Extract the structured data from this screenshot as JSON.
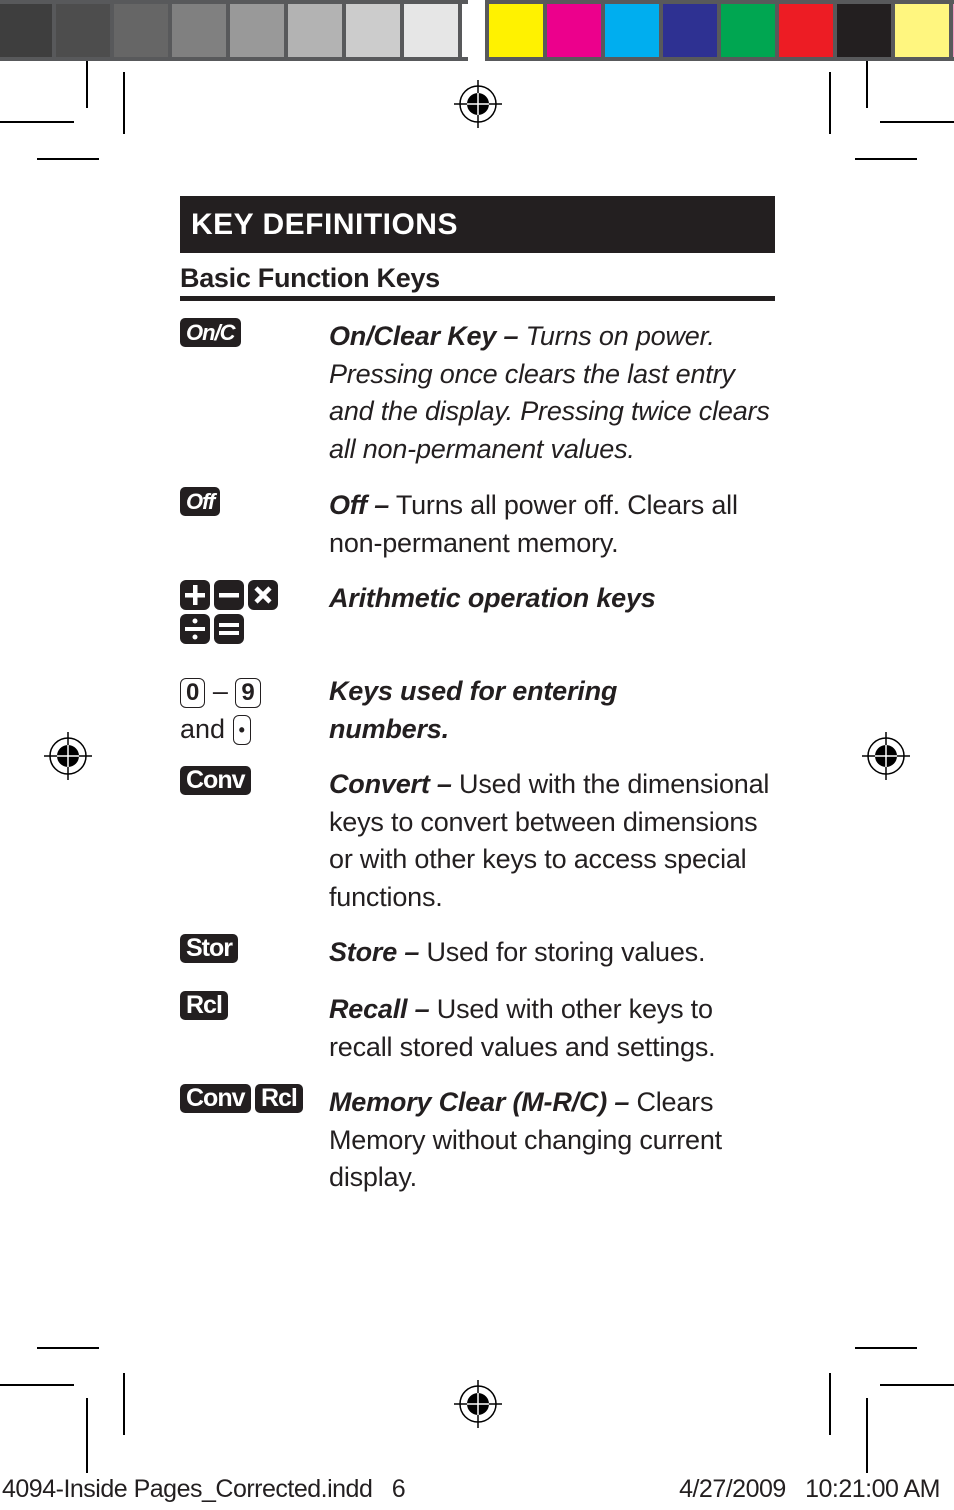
{
  "color_bar": {
    "grays": [
      "#4d4d4d",
      "#666666",
      "#808080",
      "#999999",
      "#b3b3b3",
      "#cccccc",
      "#e6e6e6",
      "#ffffff"
    ],
    "colors": [
      "#fff200",
      "#ec008c",
      "#00aeef",
      "#2e3192",
      "#00a651",
      "#ed1c24",
      "#231f20",
      "#fff67f"
    ]
  },
  "page": {
    "banner_title": "KEY DEFINITIONS",
    "section_heading": "Basic Function Keys"
  },
  "entries": [
    {
      "keys": [
        "On/C"
      ],
      "term": "On/Clear Key –",
      "text": " Turns on power. Pressing once clears the last entry and the display. Pressing twice clears all non-permanent values.",
      "text_italic": true
    },
    {
      "keys": [
        "Off"
      ],
      "term": "Off –",
      "text": " Turns all power off. Clears all non-permanent memory."
    },
    {
      "keys": [
        "plus",
        "minus",
        "multiply",
        "divide",
        "equals"
      ],
      "term": "Arithmetic operation keys",
      "text": ""
    },
    {
      "keys": [
        "0",
        "9",
        "•"
      ],
      "key_connector": "–",
      "key_and": "and",
      "term": "Keys used for entering numbers.",
      "text": ""
    },
    {
      "keys": [
        "Conv"
      ],
      "term": "Convert –",
      "text": " Used with the dimensional keys to convert between dimensions or with other keys to access special functions."
    },
    {
      "keys": [
        "Stor"
      ],
      "term": "Store –",
      "text": " Used for storing values."
    },
    {
      "keys": [
        "Rcl"
      ],
      "term": "Recall –",
      "text": " Used with other keys to recall stored values and settings."
    },
    {
      "keys": [
        "Conv",
        "Rcl"
      ],
      "term": "Memory Clear (M-R/C) –",
      "text": " Clears Memory without changing current display."
    }
  ],
  "footer": {
    "file": "4094-Inside Pages_Corrected.indd   6",
    "datetime": "4/27/2009   10:21:00 AM"
  }
}
